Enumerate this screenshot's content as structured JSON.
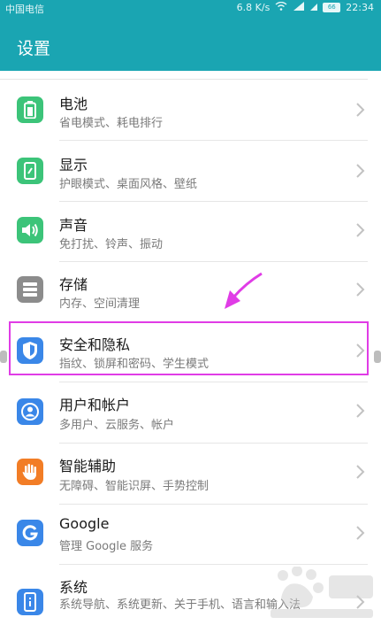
{
  "status_bar": {
    "carrier": "中国电信",
    "speed": "6.8 K/s",
    "battery": "66",
    "time": "22:34"
  },
  "header": {
    "title": "设置"
  },
  "colors": {
    "header_bg": "#1aa5b2",
    "icon_green": "#3cc479",
    "icon_gray": "#8c8c8c",
    "icon_blue": "#3a87e8",
    "icon_orange": "#f27d26",
    "highlight": "#e03ce6"
  },
  "settings_items": [
    {
      "title": "电池",
      "subtitle": "省电模式、耗电排行",
      "icon": "battery-icon"
    },
    {
      "title": "显示",
      "subtitle": "护眼模式、桌面风格、壁纸",
      "icon": "display-icon"
    },
    {
      "title": "声音",
      "subtitle": "免打扰、铃声、振动",
      "icon": "sound-icon"
    },
    {
      "title": "存储",
      "subtitle": "内存、空间清理",
      "icon": "storage-icon"
    },
    {
      "title": "安全和隐私",
      "subtitle": "指纹、锁屏和密码、学生模式",
      "icon": "shield-icon"
    },
    {
      "title": "用户和帐户",
      "subtitle": "多用户、云服务、帐户",
      "icon": "user-icon"
    },
    {
      "title": "智能辅助",
      "subtitle": "无障碍、智能识屏、手势控制",
      "icon": "hand-icon"
    },
    {
      "title": "Google",
      "subtitle": "管理 Google 服务",
      "icon": "google-icon"
    },
    {
      "title": "系统",
      "subtitle": "系统导航、系统更新、关于手机、语言和输入法",
      "icon": "system-icon"
    }
  ]
}
